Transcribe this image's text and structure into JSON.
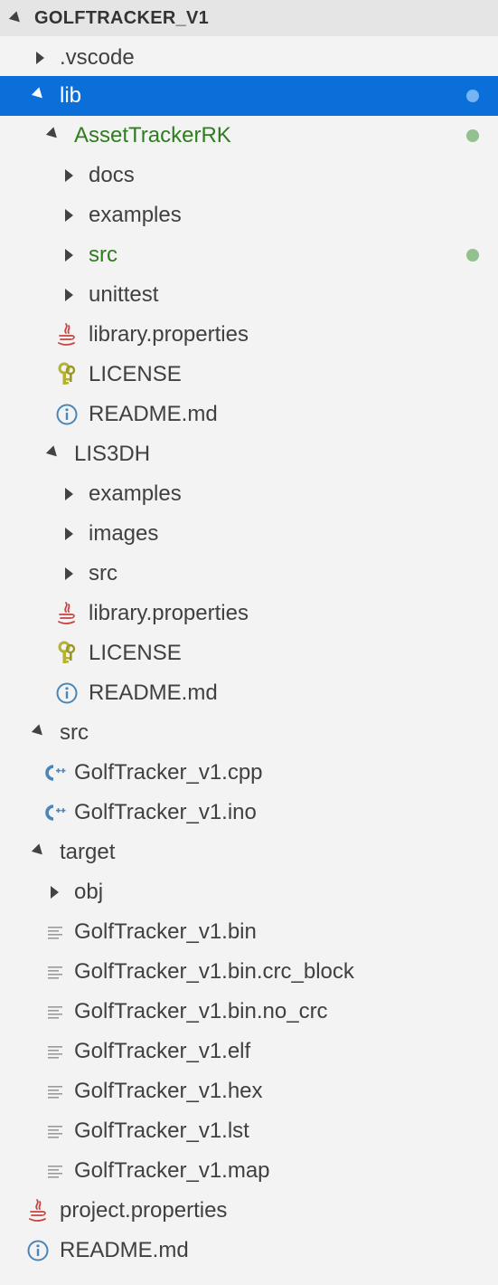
{
  "explorer": {
    "title": "GOLFTRACKER_V1",
    "rows": [
      {
        "label": ".vscode",
        "kind": "folder",
        "expanded": false
      },
      {
        "label": "lib",
        "kind": "folder",
        "expanded": true,
        "selected": true,
        "decoration": "modified-dot"
      },
      {
        "label": "AssetTrackerRK",
        "kind": "folder",
        "expanded": true,
        "decoration": "modified-dot"
      },
      {
        "label": "docs",
        "kind": "folder",
        "expanded": false
      },
      {
        "label": "examples",
        "kind": "folder",
        "expanded": false
      },
      {
        "label": "src",
        "kind": "folder",
        "expanded": false,
        "decoration": "modified-dot"
      },
      {
        "label": "unittest",
        "kind": "folder",
        "expanded": false
      },
      {
        "label": "library.properties",
        "kind": "file",
        "icon": "java-icon"
      },
      {
        "label": "LICENSE",
        "kind": "file",
        "icon": "license-key-icon"
      },
      {
        "label": "README.md",
        "kind": "file",
        "icon": "info-icon"
      },
      {
        "label": "LIS3DH",
        "kind": "folder",
        "expanded": true
      },
      {
        "label": "examples",
        "kind": "folder",
        "expanded": false
      },
      {
        "label": "images",
        "kind": "folder",
        "expanded": false
      },
      {
        "label": "src",
        "kind": "folder",
        "expanded": false
      },
      {
        "label": "library.properties",
        "kind": "file",
        "icon": "java-icon"
      },
      {
        "label": "LICENSE",
        "kind": "file",
        "icon": "license-key-icon"
      },
      {
        "label": "README.md",
        "kind": "file",
        "icon": "info-icon"
      },
      {
        "label": "src",
        "kind": "folder",
        "expanded": true
      },
      {
        "label": "GolfTracker_v1.cpp",
        "kind": "file",
        "icon": "cpp-icon"
      },
      {
        "label": "GolfTracker_v1.ino",
        "kind": "file",
        "icon": "cpp-icon"
      },
      {
        "label": "target",
        "kind": "folder",
        "expanded": true
      },
      {
        "label": "obj",
        "kind": "folder",
        "expanded": false
      },
      {
        "label": "GolfTracker_v1.bin",
        "kind": "file",
        "icon": "text-file-icon"
      },
      {
        "label": "GolfTracker_v1.bin.crc_block",
        "kind": "file",
        "icon": "text-file-icon"
      },
      {
        "label": "GolfTracker_v1.bin.no_crc",
        "kind": "file",
        "icon": "text-file-icon"
      },
      {
        "label": "GolfTracker_v1.elf",
        "kind": "file",
        "icon": "text-file-icon"
      },
      {
        "label": "GolfTracker_v1.hex",
        "kind": "file",
        "icon": "text-file-icon"
      },
      {
        "label": "GolfTracker_v1.lst",
        "kind": "file",
        "icon": "text-file-icon"
      },
      {
        "label": "GolfTracker_v1.map",
        "kind": "file",
        "icon": "text-file-icon"
      },
      {
        "label": "project.properties",
        "kind": "file",
        "icon": "java-icon"
      },
      {
        "label": "README.md",
        "kind": "file",
        "icon": "info-icon"
      }
    ]
  },
  "colors": {
    "selection_background": "#0a6fd8",
    "modified_text": "#2f7d1f",
    "modified_dot": "#92c08f",
    "selected_dot": "#75b4f5",
    "header_background": "#e5e5e5"
  }
}
